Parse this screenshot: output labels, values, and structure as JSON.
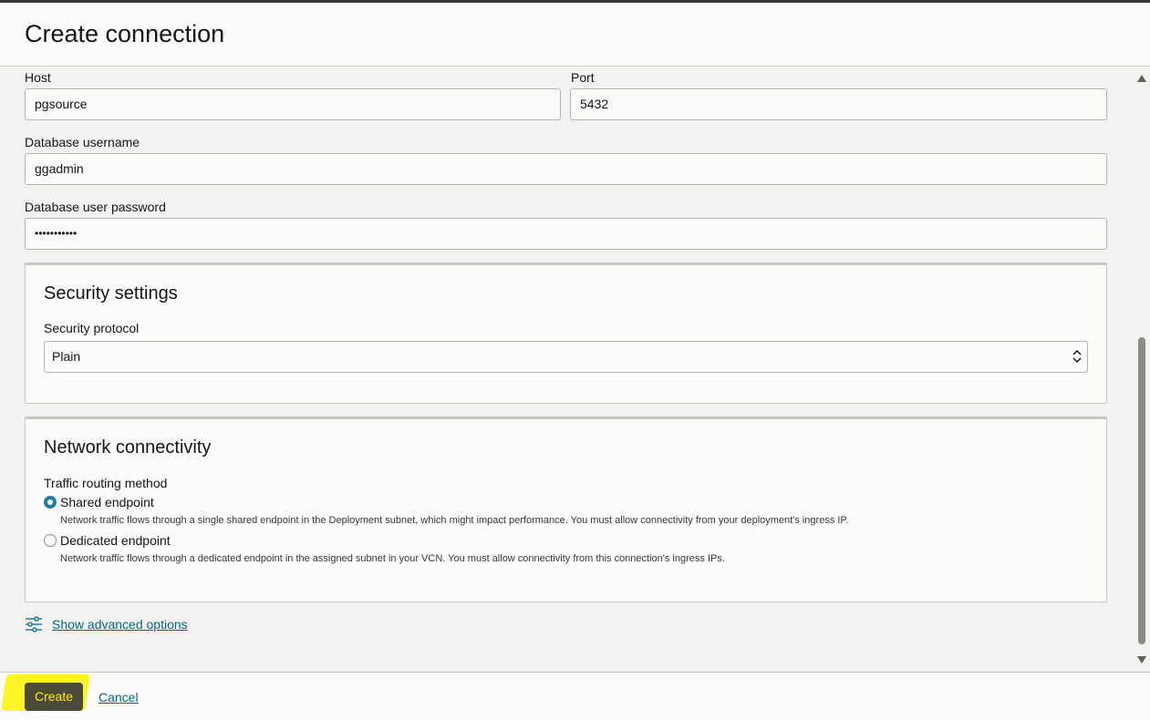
{
  "header": {
    "title": "Create connection"
  },
  "form": {
    "host": {
      "label": "Host",
      "value": "pgsource"
    },
    "port": {
      "label": "Port",
      "value": "5432"
    },
    "db_username": {
      "label": "Database username",
      "value": "ggadmin"
    },
    "db_password": {
      "label": "Database user password",
      "value": "•••••••••••"
    }
  },
  "security": {
    "title": "Security settings",
    "protocol_label": "Security protocol",
    "protocol_value": "Plain"
  },
  "network": {
    "title": "Network connectivity",
    "routing_label": "Traffic routing method",
    "options": [
      {
        "label": "Shared endpoint",
        "description": "Network traffic flows through a single shared endpoint in the Deployment subnet, which might impact performance. You must allow connectivity from your deployment's ingress IP.",
        "selected": true
      },
      {
        "label": "Dedicated endpoint",
        "description": "Network traffic flows through a dedicated endpoint in the assigned subnet in your VCN. You must allow connectivity from this connection's ingress IPs.",
        "selected": false
      }
    ]
  },
  "advanced": {
    "link_label": "Show advanced options",
    "icon": "sliders-icon"
  },
  "footer": {
    "create_label": "Create",
    "cancel_label": "Cancel"
  },
  "colors": {
    "accent": "#227e9e",
    "link": "#00688c",
    "highlight": "#fff200"
  }
}
